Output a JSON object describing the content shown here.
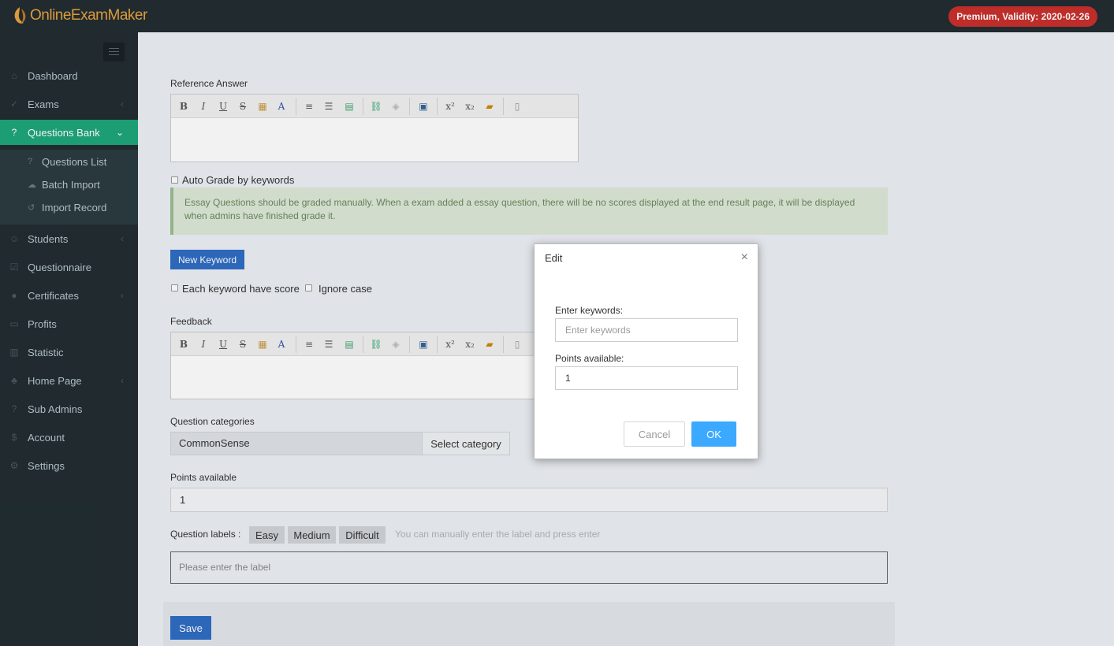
{
  "app": {
    "logo_text": "OnlineExamMaker",
    "premium_badge": "Premium, Validity: 2020-02-26",
    "colors": {
      "header_bg": "#222d32",
      "accent_green": "#1fa67a",
      "premium_red": "#c9302c",
      "primary_blue": "#2f6dc4",
      "ok_blue": "#3ba9ff"
    }
  },
  "sidebar": {
    "items": [
      {
        "label": "Dashboard",
        "icon": "home-icon",
        "has_children": false
      },
      {
        "label": "Exams",
        "icon": "check-circle-icon",
        "has_children": true
      },
      {
        "label": "Questions Bank",
        "icon": "question-circle-icon",
        "has_children": true,
        "active": true
      },
      {
        "label": "Students",
        "icon": "users-icon",
        "has_children": true
      },
      {
        "label": "Questionnaire",
        "icon": "checkbox-icon",
        "has_children": false
      },
      {
        "label": "Certificates",
        "icon": "certificate-icon",
        "has_children": true
      },
      {
        "label": "Profits",
        "icon": "credit-card-icon",
        "has_children": false
      },
      {
        "label": "Statistic",
        "icon": "bar-chart-icon",
        "has_children": false
      },
      {
        "label": "Home Page",
        "icon": "tree-icon",
        "has_children": true
      },
      {
        "label": "Sub Admins",
        "icon": "question-circle-icon",
        "has_children": false
      },
      {
        "label": "Account",
        "icon": "dollar-icon",
        "has_children": false
      },
      {
        "label": "Settings",
        "icon": "gear-icon",
        "has_children": false
      }
    ],
    "subitems": [
      {
        "label": "Questions List",
        "icon": "question-circle-icon"
      },
      {
        "label": "Batch Import",
        "icon": "cloud-upload-icon"
      },
      {
        "label": "Import Record",
        "icon": "history-icon"
      }
    ]
  },
  "form": {
    "reference_answer_label": "Reference Answer",
    "auto_grade_label": "Auto Grade by keywords",
    "essay_note": "Essay Questions should be graded manually. When a exam added a essay question, there will be no scores displayed at the end result page, it will be displayed when admins have finished grade it.",
    "new_keyword_button": "New Keyword",
    "each_keyword_score_label": "Each keyword have score",
    "ignore_case_label": "Ignore case",
    "feedback_label": "Feedback",
    "question_categories_label": "Question categories",
    "category_value": "CommonSense",
    "select_category_button": "Select category",
    "points_available_label": "Points available",
    "points_available_value": "1",
    "question_labels_label": "Question labels :",
    "label_tags": [
      "Easy",
      "Medium",
      "Difficult"
    ],
    "label_hint": "You can manually enter the label and press enter",
    "label_input_placeholder": "Please enter the label",
    "save_button": "Save"
  },
  "toolbar_icons": [
    "bold-icon",
    "italic-icon",
    "underline-icon",
    "strikethrough-icon",
    "text-color-icon",
    "background-color-icon",
    "ordered-list-icon",
    "unordered-list-icon",
    "table-icon",
    "link-icon",
    "unlink-icon",
    "image-icon",
    "superscript-icon",
    "subscript-icon",
    "paste-icon",
    "source-icon"
  ],
  "modal": {
    "title": "Edit",
    "keywords_label": "Enter keywords:",
    "keywords_placeholder": "Enter keywords",
    "points_label": "Points available:",
    "points_value": "1",
    "cancel_button": "Cancel",
    "ok_button": "OK"
  }
}
